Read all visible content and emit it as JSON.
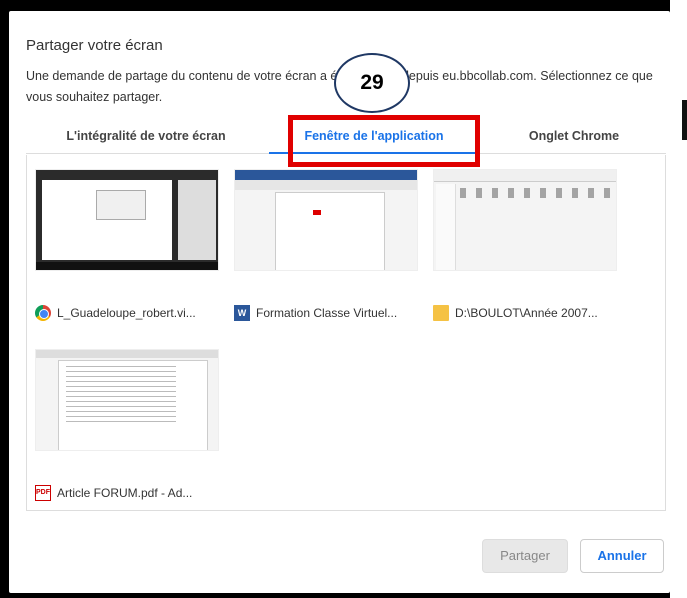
{
  "dialog": {
    "title": "Partager votre écran",
    "description": "Une demande de partage du contenu de votre écran a été envoyée depuis eu.bbcollab.com. Sélectionnez ce que vous souhaitez partager."
  },
  "badge": {
    "number": "29"
  },
  "tabs": [
    {
      "label": "L'intégralité de votre écran"
    },
    {
      "label": "Fenêtre de l'application"
    },
    {
      "label": "Onglet Chrome"
    }
  ],
  "windows": [
    {
      "label": "L_Guadeloupe_robert.vi...",
      "icon": "chrome-icon"
    },
    {
      "label": "Formation Classe Virtuel...",
      "icon": "word-icon"
    },
    {
      "label": "D:\\BOULOT\\Année 2007...",
      "icon": "folder-icon"
    },
    {
      "label": "Article FORUM.pdf - Ad...",
      "icon": "pdf-icon"
    }
  ],
  "buttons": {
    "share": "Partager",
    "cancel": "Annuler"
  },
  "colors": {
    "accent": "#1a73e8",
    "highlight": "#e00000"
  }
}
